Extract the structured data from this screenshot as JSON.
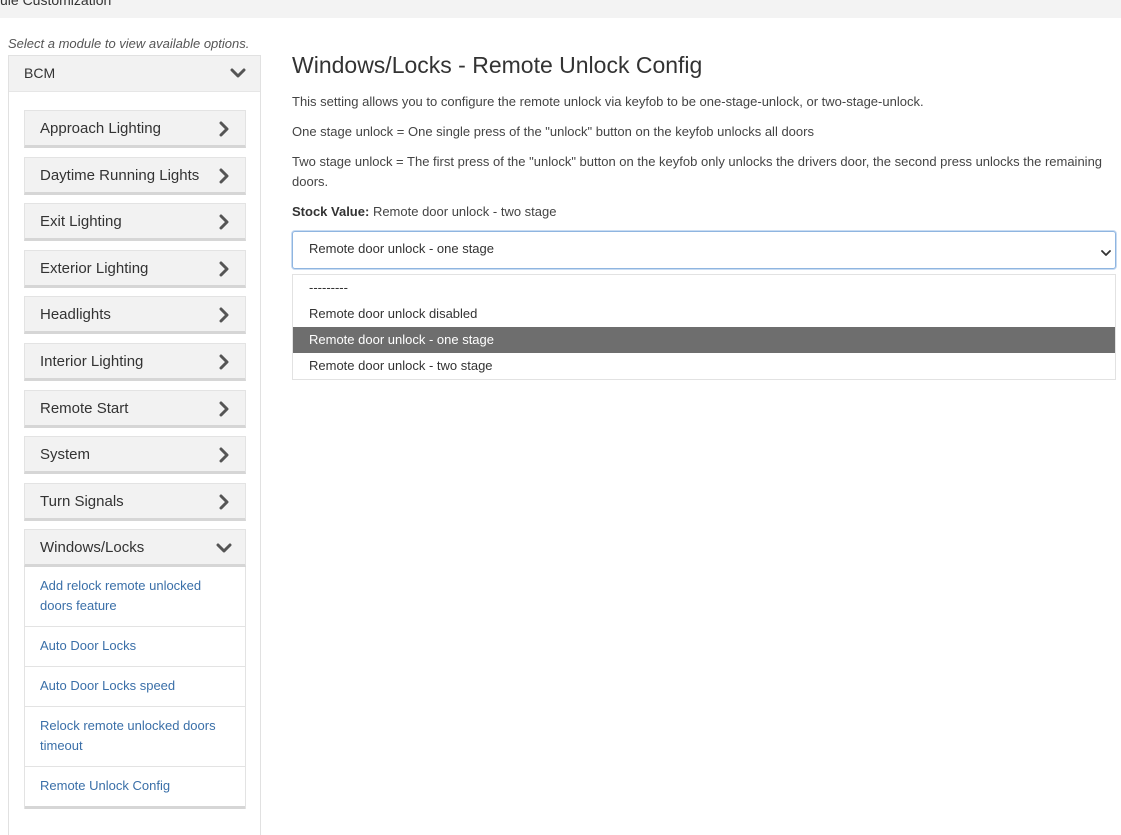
{
  "header": {
    "title": "ule Customization"
  },
  "sidebar": {
    "hint": "Select a module to view available options.",
    "module_label": "BCM",
    "items": [
      {
        "label": "Approach Lighting"
      },
      {
        "label": "Daytime Running Lights"
      },
      {
        "label": "Exit Lighting"
      },
      {
        "label": "Exterior Lighting"
      },
      {
        "label": "Headlights"
      },
      {
        "label": "Interior Lighting"
      },
      {
        "label": "Remote Start"
      },
      {
        "label": "System"
      },
      {
        "label": "Turn Signals"
      },
      {
        "label": "Windows/Locks"
      }
    ],
    "sub_items": [
      {
        "label": "Add relock remote unlocked doors feature"
      },
      {
        "label": "Auto Door Locks"
      },
      {
        "label": "Auto Door Locks speed"
      },
      {
        "label": "Relock remote unlocked doors timeout"
      },
      {
        "label": "Remote Unlock Config"
      }
    ]
  },
  "main": {
    "title": "Windows/Locks - Remote Unlock Config",
    "description": "This setting allows you to configure the remote unlock via keyfob to be one-stage-unlock, or two-stage-unlock.",
    "one_stage_note": "One stage unlock = One single press of the \"unlock\" button on the keyfob unlocks all doors",
    "two_stage_note": "Two stage unlock = The first press of the \"unlock\" button on the keyfob only unlocks the drivers door, the second press unlocks the remaining doors.",
    "stock_label": "Stock Value:",
    "stock_value": "Remote door unlock - two stage",
    "select": {
      "value": "Remote door unlock - one stage",
      "options": [
        {
          "label": "---------"
        },
        {
          "label": "Remote door unlock disabled"
        },
        {
          "label": "Remote door unlock - one stage"
        },
        {
          "label": "Remote door unlock - two stage"
        }
      ],
      "selected_index": 2
    }
  },
  "colors": {
    "link": "#3a6fa8",
    "selected_option_bg": "#6e6e6e",
    "panel_bg": "#f2f2f2",
    "focus_border": "#8fb5e0"
  },
  "icons": {
    "collapsed": "chevron-right-icon",
    "expanded": "chevron-down-icon",
    "select_caret": "chevron-down-icon"
  }
}
